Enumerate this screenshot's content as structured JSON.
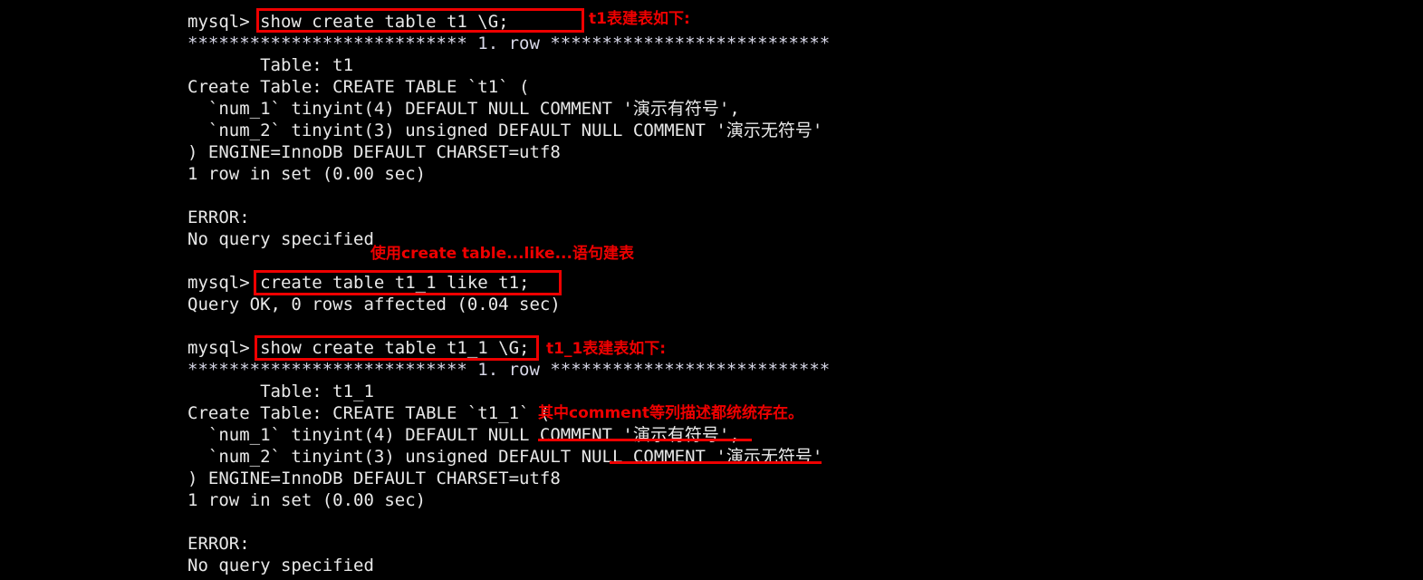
{
  "terminal": {
    "background_color": "#000000",
    "text_color": "#e8e8e8",
    "annotation_color": "#ee0000",
    "lines": [
      {
        "id": "l01",
        "text": "mysql> show create table t1 \\G;"
      },
      {
        "id": "l02",
        "text": "*************************** 1. row ***************************"
      },
      {
        "id": "l03",
        "text": "       Table: t1"
      },
      {
        "id": "l04",
        "text": "Create Table: CREATE TABLE `t1` ("
      },
      {
        "id": "l05",
        "text": "  `num_1` tinyint(4) DEFAULT NULL COMMENT '演示有符号',"
      },
      {
        "id": "l06",
        "text": "  `num_2` tinyint(3) unsigned DEFAULT NULL COMMENT '演示无符号'"
      },
      {
        "id": "l07",
        "text": ") ENGINE=InnoDB DEFAULT CHARSET=utf8"
      },
      {
        "id": "l08",
        "text": "1 row in set (0.00 sec)"
      },
      {
        "id": "l09",
        "text": ""
      },
      {
        "id": "l10",
        "text": "ERROR:"
      },
      {
        "id": "l11",
        "text": "No query specified"
      },
      {
        "id": "l12",
        "text": ""
      },
      {
        "id": "l13",
        "text": "mysql> create table t1_1 like t1;"
      },
      {
        "id": "l14",
        "text": "Query OK, 0 rows affected (0.04 sec)"
      },
      {
        "id": "l15",
        "text": ""
      },
      {
        "id": "l16",
        "text": "mysql> show create table t1_1 \\G;"
      },
      {
        "id": "l17",
        "text": "*************************** 1. row ***************************"
      },
      {
        "id": "l18",
        "text": "       Table: t1_1"
      },
      {
        "id": "l19",
        "text": "Create Table: CREATE TABLE `t1_1` ("
      },
      {
        "id": "l20",
        "text": "  `num_1` tinyint(4) DEFAULT NULL COMMENT '演示有符号',"
      },
      {
        "id": "l21",
        "text": "  `num_2` tinyint(3) unsigned DEFAULT NULL COMMENT '演示无符号'"
      },
      {
        "id": "l22",
        "text": ") ENGINE=InnoDB DEFAULT CHARSET=utf8"
      },
      {
        "id": "l23",
        "text": "1 row in set (0.00 sec)"
      },
      {
        "id": "l24",
        "text": ""
      },
      {
        "id": "l25",
        "text": "ERROR:"
      },
      {
        "id": "l26",
        "text": "No query specified"
      }
    ]
  },
  "annotations": {
    "labels": [
      {
        "id": "a1",
        "text": "t1表建表如下:"
      },
      {
        "id": "a2",
        "text": "使用create table...like...语句建表"
      },
      {
        "id": "a3",
        "text": "t1_1表建表如下:"
      },
      {
        "id": "a4",
        "text": "其中comment等列描述都统统存在。"
      }
    ],
    "boxed_commands": [
      {
        "id": "b1",
        "command": "show create table t1 \\G;"
      },
      {
        "id": "b2",
        "command": "create table t1_1 like t1;"
      },
      {
        "id": "b3",
        "command": "show create table t1_1 \\G;"
      }
    ],
    "underlined_fragments": [
      {
        "id": "u1",
        "text": "COMMENT '演示有符号',"
      },
      {
        "id": "u2",
        "text": "COMMENT '演示无符号'"
      }
    ]
  }
}
